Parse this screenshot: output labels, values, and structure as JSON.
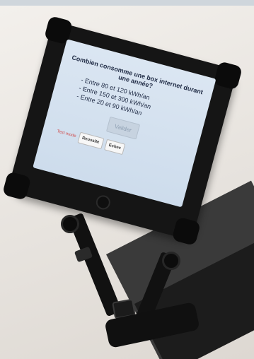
{
  "quiz": {
    "question": "Combien consomme une box internet durant une année?",
    "options": [
      "- Entre 80 et 120 kWh/an",
      "- Entre 150 et 300 kWh/an",
      "- Entre 20 et 90 kWh/an"
    ],
    "validate_label": "Valider",
    "test_mode_label": "Test mode",
    "success_label": "Reussite",
    "fail_label": "Echec"
  }
}
